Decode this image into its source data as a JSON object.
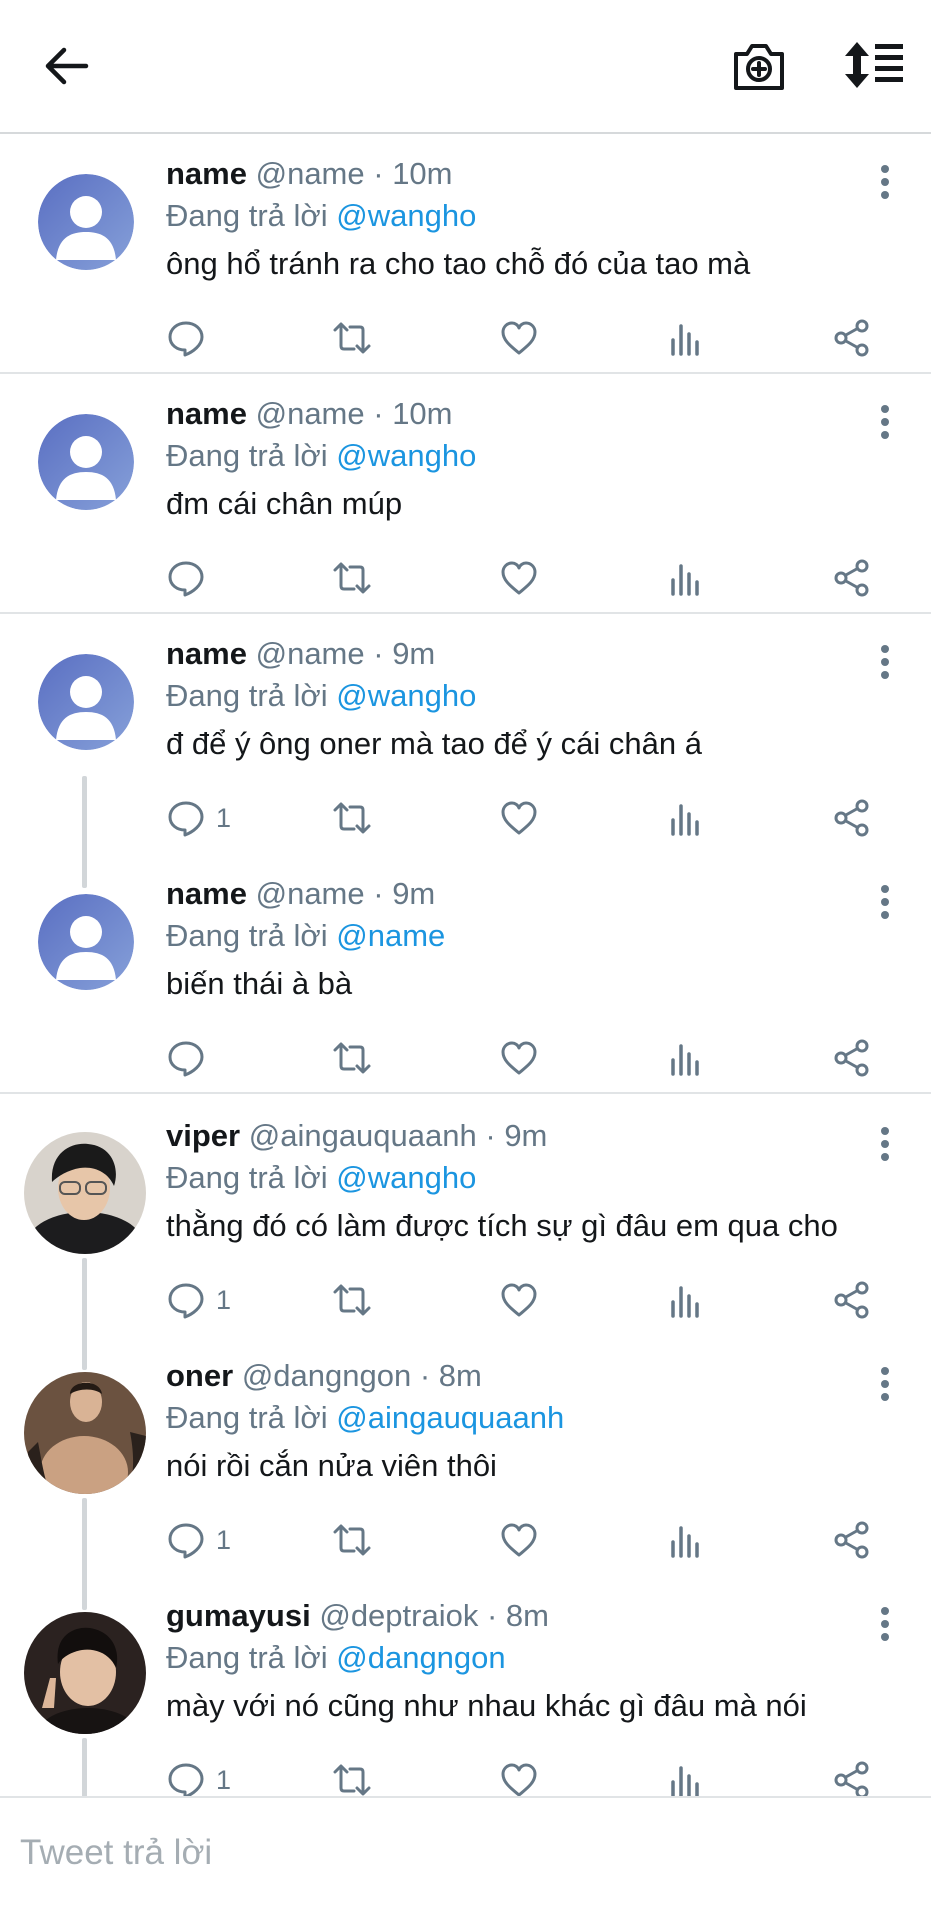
{
  "header": {
    "back_icon": "arrow-left-icon",
    "camera_icon": "camera-plus-icon",
    "sort_icon": "sort-list-icon"
  },
  "replying_to_label": "Đang trả lời",
  "tweets": [
    {
      "name": "name",
      "handle": "@name",
      "time": "10m",
      "mention": "@wangho",
      "text": "ông hổ tránh ra cho tao chỗ đó của tao mà",
      "reply_count": "",
      "avatar": "default"
    },
    {
      "name": "name",
      "handle": "@name",
      "time": "10m",
      "mention": "@wangho",
      "text": "đm cái chân múp",
      "reply_count": "",
      "avatar": "default"
    },
    {
      "name": "name",
      "handle": "@name",
      "time": "9m",
      "mention": "@wangho",
      "text": "đ để ý ông oner mà tao để ý cái chân á",
      "reply_count": "1",
      "avatar": "default"
    },
    {
      "name": "name",
      "handle": "@name",
      "time": "9m",
      "mention": "@name",
      "text": "biến thái à bà",
      "reply_count": "",
      "avatar": "default"
    },
    {
      "name": "viper",
      "handle": "@aingauquaanh",
      "time": "9m",
      "mention": "@wangho",
      "text": "thằng đó có làm được tích sự gì đâu em qua cho",
      "reply_count": "1",
      "avatar": "photo"
    },
    {
      "name": "oner",
      "handle": "@dangngon",
      "time": "8m",
      "mention": "@aingauquaanh",
      "text": "nói rồi cắn nửa viên thôi",
      "reply_count": "1",
      "avatar": "photo"
    },
    {
      "name": "gumayusi",
      "handle": "@deptraiok",
      "time": "8m",
      "mention": "@dangngon",
      "text": "mày với nó cũng như nhau khác gì đâu mà nói",
      "reply_count": "1",
      "avatar": "photo"
    }
  ],
  "reply_input": {
    "placeholder": "Tweet trả lời"
  },
  "colors": {
    "link": "#1b95e0",
    "muted": "#657786",
    "avatar_default": "#6f87cc"
  }
}
